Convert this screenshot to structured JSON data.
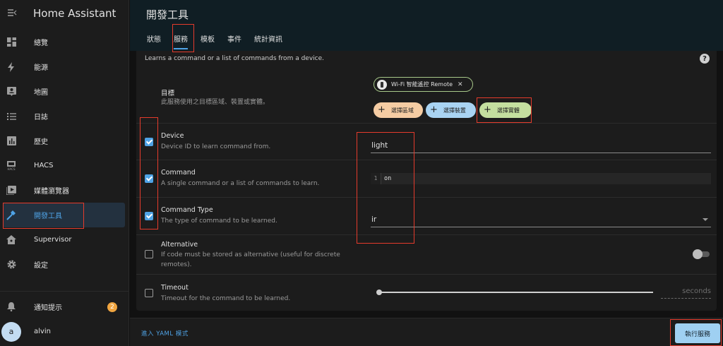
{
  "app": {
    "title": "Home Assistant"
  },
  "sidebar": {
    "items": [
      {
        "id": "overview",
        "label": "總覽",
        "icon": "dashboard-icon"
      },
      {
        "id": "energy",
        "label": "能源",
        "icon": "lightning-icon"
      },
      {
        "id": "map",
        "label": "地圖",
        "icon": "map-account-icon"
      },
      {
        "id": "logbook",
        "label": "日誌",
        "icon": "list-icon"
      },
      {
        "id": "history",
        "label": "歷史",
        "icon": "chart-box-icon"
      },
      {
        "id": "hacs",
        "label": "HACS",
        "icon": "hacs-icon"
      },
      {
        "id": "media",
        "label": "媒體瀏覽器",
        "icon": "play-box-icon"
      },
      {
        "id": "devtools",
        "label": "開發工具",
        "icon": "hammer-icon",
        "active": true
      },
      {
        "id": "supervisor",
        "label": "Supervisor",
        "icon": "home-assistant-icon"
      },
      {
        "id": "settings",
        "label": "設定",
        "icon": "gear-icon"
      }
    ],
    "notifications": {
      "label": "通知提示",
      "count": "2"
    },
    "user": {
      "name": "alvin",
      "initial": "a"
    }
  },
  "header": {
    "title": "開發工具",
    "tabs": [
      {
        "label": "狀態"
      },
      {
        "label": "服務",
        "active": true
      },
      {
        "label": "模板"
      },
      {
        "label": "事件"
      },
      {
        "label": "統計資訊"
      }
    ]
  },
  "service": {
    "description": "Learns a command or a list of commands from a device.",
    "target": {
      "label": "目標",
      "sub": "此服務使用之目標區域、裝置或實體。",
      "entity_chip": "Wi-Fi 智能遙控 Remote",
      "add_area": "選擇區域",
      "add_device": "選擇裝置",
      "add_entity": "選擇實體"
    },
    "fields": {
      "device": {
        "label": "Device",
        "sub": "Device ID to learn command from.",
        "value": "light",
        "checked": true
      },
      "command": {
        "label": "Command",
        "sub": "A single command or a list of commands to learn.",
        "line_number": "1",
        "value": "on",
        "checked": true
      },
      "command_type": {
        "label": "Command Type",
        "sub": "The type of command to be learned.",
        "value": "ir",
        "checked": true
      },
      "alternative": {
        "label": "Alternative",
        "sub": "If code must be stored as alternative (useful for discrete remotes).",
        "checked": false
      },
      "timeout": {
        "label": "Timeout",
        "sub": "Timeout for the command to be learned.",
        "unit": "seconds",
        "checked": false
      }
    }
  },
  "footer": {
    "yaml_link": "進入 YAML 模式",
    "run_button": "執行服務"
  },
  "colors": {
    "accent": "#4fa3e6",
    "annotation": "#e53b2c",
    "badge": "#f0a540"
  }
}
